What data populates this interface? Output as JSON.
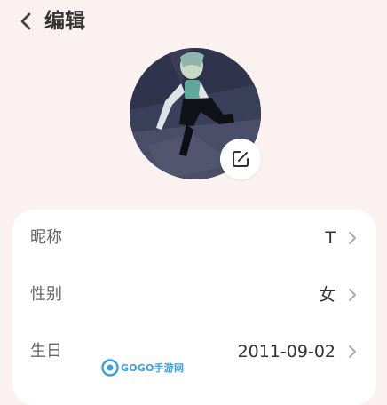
{
  "header": {
    "title": "编辑",
    "back_icon": "chevron-left-icon"
  },
  "avatar": {
    "edit_icon": "edit-square-icon"
  },
  "profile_fields": [
    {
      "label": "昵称",
      "value": "T"
    },
    {
      "label": "性别",
      "value": "女"
    },
    {
      "label": "生日",
      "value": "2011-09-02"
    }
  ],
  "watermark": {
    "text": "GOGO手游网"
  },
  "colors": {
    "background": "#fbf1f1",
    "card": "#ffffff",
    "title_text": "#333333",
    "label_text": "#666666",
    "chevron": "#aaaaaa"
  }
}
